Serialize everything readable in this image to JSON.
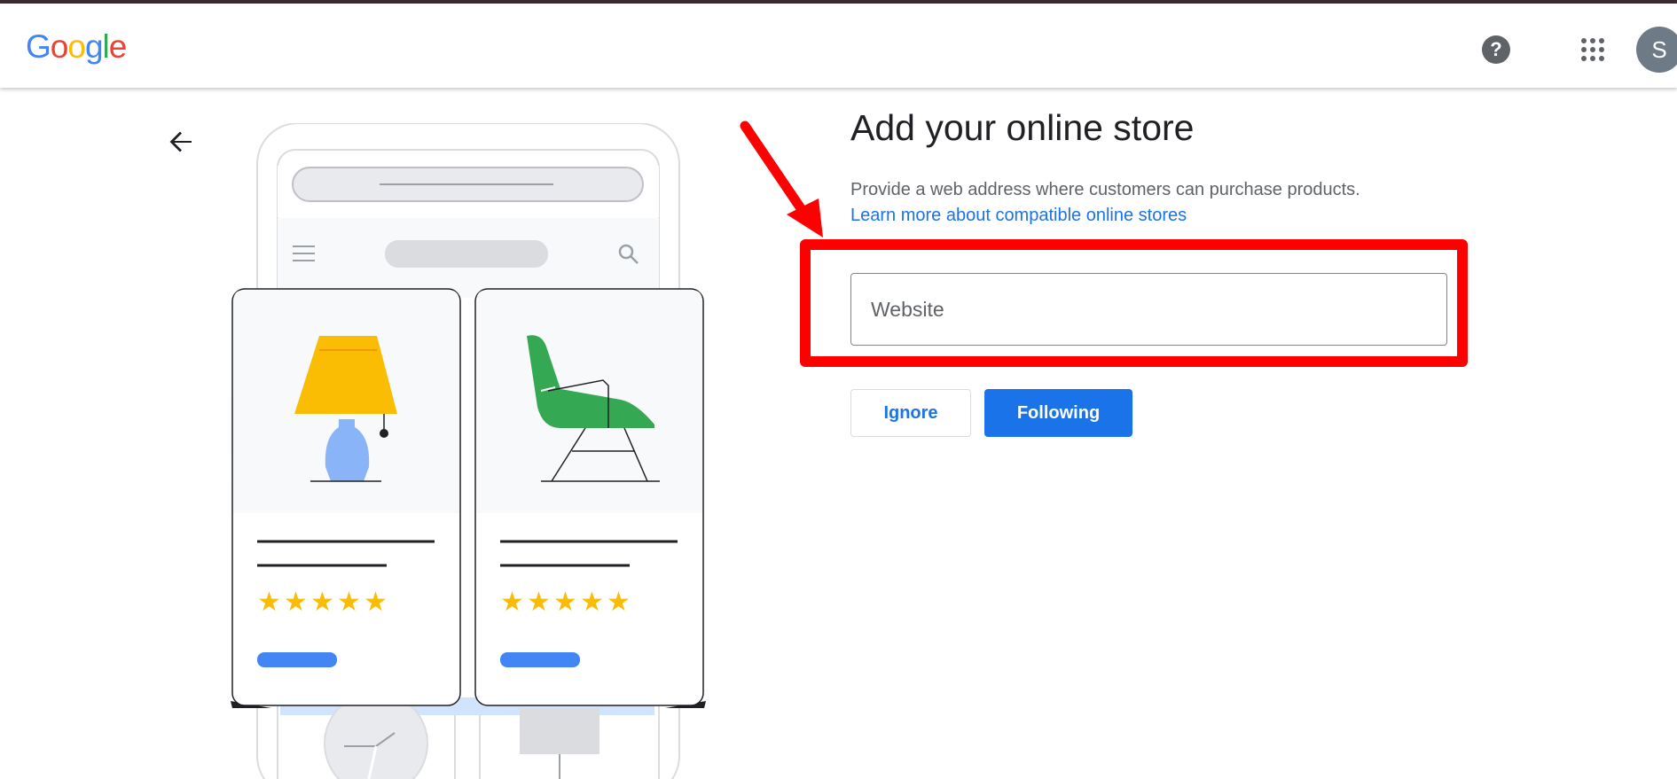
{
  "header": {
    "logo_letters": [
      {
        "ch": "G",
        "color": "#4285F4"
      },
      {
        "ch": "o",
        "color": "#EA4335"
      },
      {
        "ch": "o",
        "color": "#FBBC05"
      },
      {
        "ch": "g",
        "color": "#4285F4"
      },
      {
        "ch": "l",
        "color": "#34A853"
      },
      {
        "ch": "e",
        "color": "#EA4335"
      }
    ],
    "help_icon": "help-circle-icon",
    "help_label": "?",
    "apps_icon": "apps-grid-icon",
    "avatar_initial": "S"
  },
  "page": {
    "back_icon": "arrow-left-icon",
    "title": "Add your online store",
    "description": "Provide a web address where customers can purchase products.",
    "learn_more": "Learn more about compatible online stores",
    "website_placeholder": "Website",
    "website_value": "",
    "ignore_label": "Ignore",
    "following_label": "Following"
  },
  "colors": {
    "primary": "#1a73e8",
    "highlight": "#ff0000",
    "star": "#fbbc04",
    "lamp_shade": "#fbbc04",
    "lamp_base": "#8ab4f8",
    "chair": "#34a853"
  },
  "illustration": {
    "products": [
      {
        "name": "lamp",
        "rating_stars": 5
      },
      {
        "name": "chair",
        "rating_stars": 5
      }
    ]
  }
}
